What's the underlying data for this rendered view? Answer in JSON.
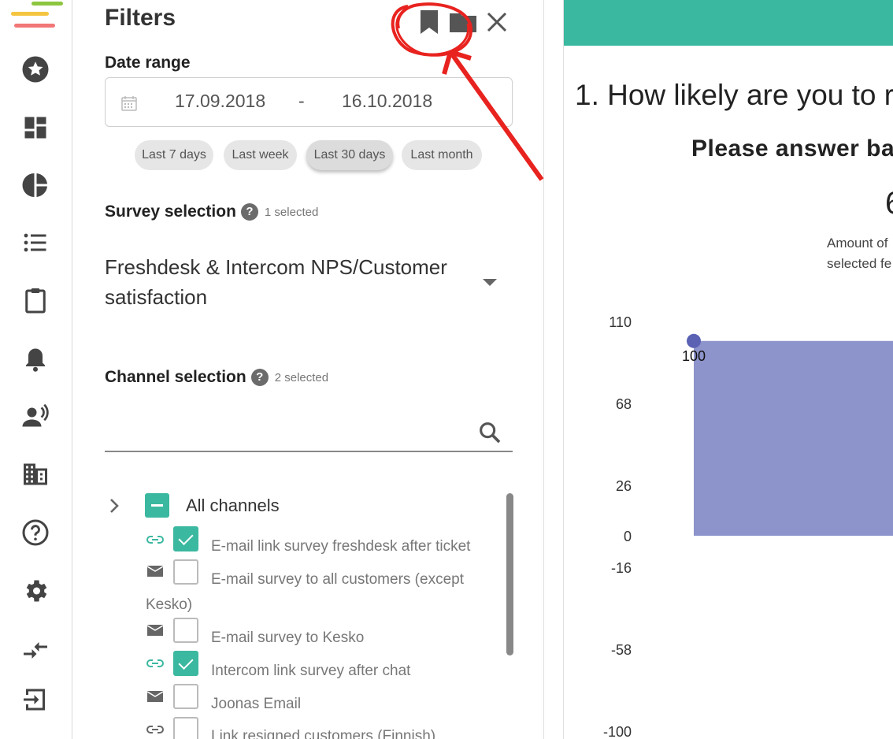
{
  "colors": {
    "accent": "#3bb8a0",
    "chart_area": "#8d93cb",
    "chart_point": "#5b62b4",
    "annotation": "#e8231f"
  },
  "rail": {
    "items": [
      {
        "name": "favorites-icon"
      },
      {
        "name": "dashboard-icon"
      },
      {
        "name": "pie-chart-icon"
      },
      {
        "name": "list-icon"
      },
      {
        "name": "clipboard-icon"
      },
      {
        "name": "bell-icon"
      },
      {
        "name": "voice-user-icon"
      },
      {
        "name": "building-icon"
      },
      {
        "name": "help-circle-icon"
      },
      {
        "name": "settings-gear-icon"
      },
      {
        "name": "compress-arrows-icon"
      },
      {
        "name": "logout-icon"
      }
    ]
  },
  "filters": {
    "title": "Filters",
    "date_range": {
      "label": "Date range",
      "from": "17.09.2018",
      "separator": "-",
      "to": "16.10.2018",
      "quick": [
        "Last 7 days",
        "Last week",
        "Last 30 days",
        "Last month"
      ],
      "active": "Last 30 days"
    },
    "survey": {
      "label": "Survey selection",
      "help": "?",
      "count": "1 selected",
      "value": "Freshdesk & Intercom NPS/Customer satisfaction"
    },
    "channel": {
      "label": "Channel selection",
      "help": "?",
      "count": "2 selected",
      "search_placeholder": "",
      "all_label": "All channels",
      "items": [
        {
          "icon": "link-icon",
          "label": "E-mail link survey freshdesk after ticket",
          "checked": true
        },
        {
          "icon": "mail-icon",
          "label": "E-mail survey to all customers (except",
          "label2": "Kesko)",
          "checked": false
        },
        {
          "icon": "mail-icon",
          "label": "E-mail survey to Kesko",
          "checked": false
        },
        {
          "icon": "link-icon",
          "label": "Intercom link survey after chat",
          "checked": true
        },
        {
          "icon": "mail-icon",
          "label": "Joonas Email",
          "checked": false
        },
        {
          "icon": "link-icon",
          "label": "Link resigned customers (Finnish)",
          "checked": false
        }
      ]
    }
  },
  "report": {
    "question": "1. How likely are you to r",
    "subtitle": "Please answer ba",
    "big_number": "6",
    "amount_line1": "Amount of",
    "amount_line2": "selected fe"
  },
  "chart_data": {
    "type": "area",
    "y_ticks": [
      "110",
      "68",
      "26",
      "0",
      "-16",
      "-58",
      "-100"
    ],
    "x": [
      0
    ],
    "series": [
      {
        "values": [
          100
        ]
      }
    ],
    "data_labels": [
      "100"
    ]
  }
}
